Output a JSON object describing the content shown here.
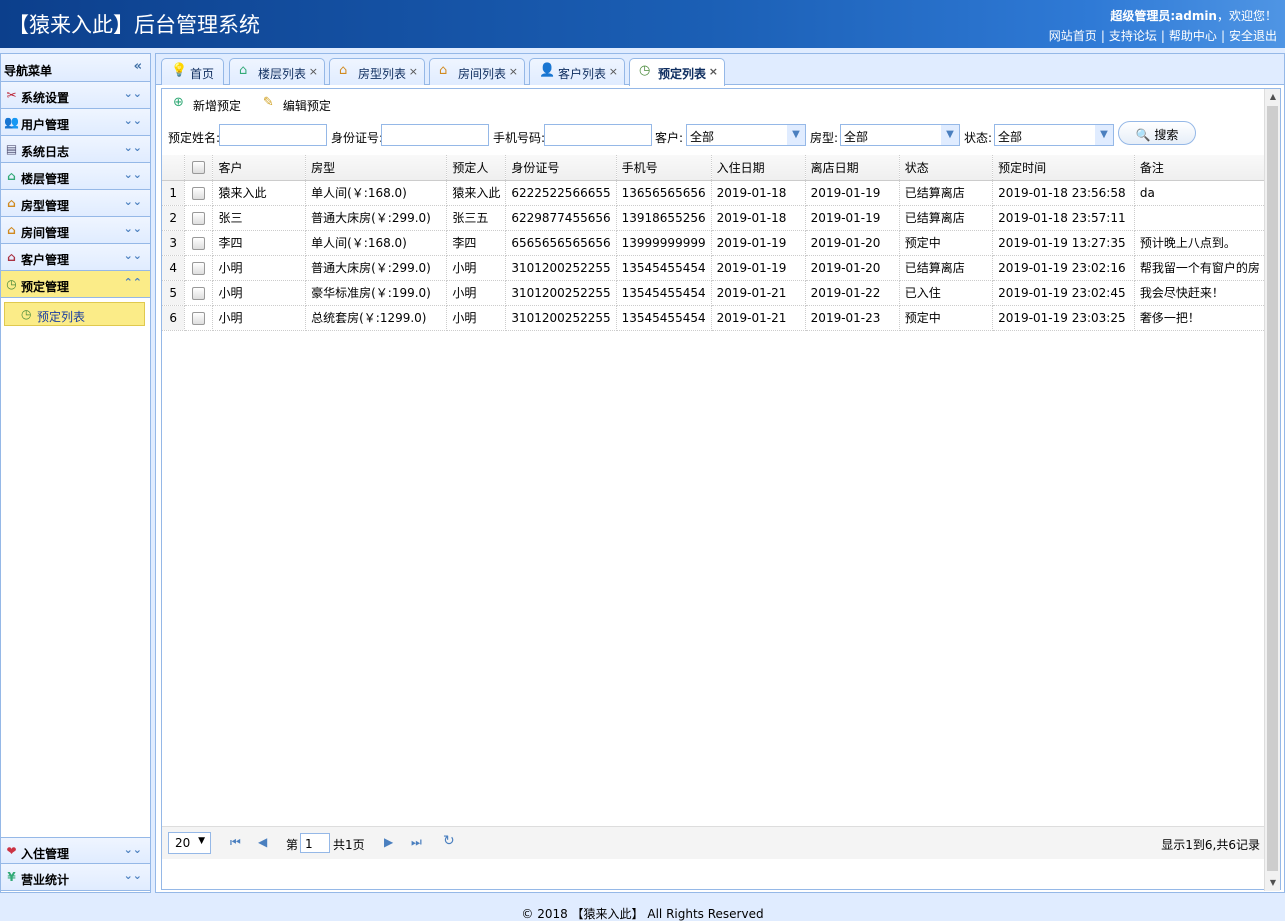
{
  "header": {
    "title": "【猿来入此】后台管理系统",
    "welcome_user": "超级管理员:admin",
    "welcome_suffix": "，欢迎您！",
    "links": [
      "网站首页",
      "支持论坛",
      "帮助中心",
      "安全退出"
    ]
  },
  "sidebar": {
    "title": "导航菜单",
    "items": [
      {
        "label": "系统设置",
        "icon": "tools-icon"
      },
      {
        "label": "用户管理",
        "icon": "users-icon"
      },
      {
        "label": "系统日志",
        "icon": "log-icon"
      },
      {
        "label": "楼层管理",
        "icon": "building-icon"
      },
      {
        "label": "房型管理",
        "icon": "house-icon"
      },
      {
        "label": "房间管理",
        "icon": "house-icon"
      },
      {
        "label": "客户管理",
        "icon": "customer-icon"
      },
      {
        "label": "预定管理",
        "icon": "clock-icon",
        "selected": true
      }
    ],
    "subitems": [
      {
        "label": "预定列表",
        "icon": "clock-icon"
      }
    ],
    "bottom_items": [
      {
        "label": "入住管理",
        "icon": "checkin-icon"
      },
      {
        "label": "营业统计",
        "icon": "yen-icon"
      }
    ]
  },
  "tabs": [
    {
      "label": "首页",
      "icon": "lightbulb-icon",
      "closable": false
    },
    {
      "label": "楼层列表",
      "icon": "building-icon",
      "closable": true
    },
    {
      "label": "房型列表",
      "icon": "house-icon",
      "closable": true
    },
    {
      "label": "房间列表",
      "icon": "house-icon",
      "closable": true
    },
    {
      "label": "客户列表",
      "icon": "customer-icon",
      "closable": true
    },
    {
      "label": "预定列表",
      "icon": "clock-icon",
      "closable": true,
      "active": true
    }
  ],
  "toolbar": {
    "add_label": "新增预定",
    "edit_label": "编辑预定"
  },
  "filters": {
    "name_label": "预定姓名:",
    "idcard_label": "身份证号:",
    "phone_label": "手机号码:",
    "customer_label": "客户:",
    "customer_value": "全部",
    "roomtype_label": "房型:",
    "roomtype_value": "全部",
    "status_label": "状态:",
    "status_value": "全部",
    "search_label": "搜索"
  },
  "table": {
    "columns": [
      "客户",
      "房型",
      "预定人",
      "身份证号",
      "手机号",
      "入住日期",
      "离店日期",
      "状态",
      "预定时间",
      "备注"
    ],
    "rows": [
      [
        "猿来入此",
        "单人间(￥:168.0)",
        "猿来入此",
        "6222522566655",
        "13656565656",
        "2019-01-18",
        "2019-01-19",
        "已结算离店",
        "2019-01-18 23:56:58",
        "da"
      ],
      [
        "张三",
        "普通大床房(￥:299.0)",
        "张三五",
        "6229877455656",
        "13918655256",
        "2019-01-18",
        "2019-01-19",
        "已结算离店",
        "2019-01-18 23:57:11",
        ""
      ],
      [
        "李四",
        "单人间(￥:168.0)",
        "李四",
        "6565656565656",
        "13999999999",
        "2019-01-19",
        "2019-01-20",
        "预定中",
        "2019-01-19 13:27:35",
        "预计晚上八点到。"
      ],
      [
        "小明",
        "普通大床房(￥:299.0)",
        "小明",
        "3101200252255",
        "13545455454",
        "2019-01-19",
        "2019-01-20",
        "已结算离店",
        "2019-01-19 23:02:16",
        "帮我留一个有窗户的房"
      ],
      [
        "小明",
        "豪华标准房(￥:199.0)",
        "小明",
        "3101200252255",
        "13545455454",
        "2019-01-21",
        "2019-01-22",
        "已入住",
        "2019-01-19 23:02:45",
        "我会尽快赶来！"
      ],
      [
        "小明",
        "总统套房(￥:1299.0)",
        "小明",
        "3101200252255",
        "13545455454",
        "2019-01-21",
        "2019-01-23",
        "预定中",
        "2019-01-19 23:03:25",
        "奢侈一把！"
      ]
    ]
  },
  "pager": {
    "page_size": "20",
    "page_prefix": "第",
    "page_value": "1",
    "page_suffix": "共1页",
    "info": "显示1到6,共6记录"
  },
  "footer": {
    "text": "© 2018 【猿来入此】 All Rights Reserved"
  },
  "colors": {
    "header_start": "#0c3f8c",
    "border": "#95B8E7",
    "panel_bg": "#E0ECFF",
    "selected": "#FBEC88"
  }
}
